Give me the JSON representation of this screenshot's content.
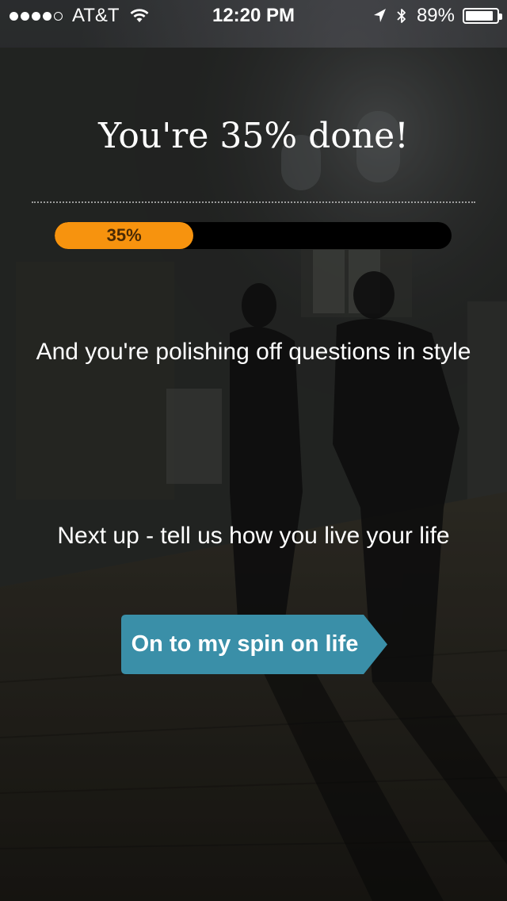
{
  "status_bar": {
    "carrier": "AT&T",
    "time": "12:20 PM",
    "battery_percent": "89%",
    "battery_level": 0.89,
    "signal_bars_filled": 4,
    "signal_bars_total": 5,
    "icons": [
      "wifi-icon",
      "location-icon",
      "bluetooth-icon",
      "battery-icon"
    ]
  },
  "main": {
    "headline": "You're 35% done!",
    "progress": {
      "value": 0.35,
      "label": "35%"
    },
    "message": "And you're polishing off questions in style",
    "next_up": "Next up - tell us how you live your life",
    "cta_label": "On to my spin on life"
  },
  "colors": {
    "progress_fill": "#f7930e",
    "progress_track": "#000000",
    "cta_background": "#3a8fa8"
  }
}
